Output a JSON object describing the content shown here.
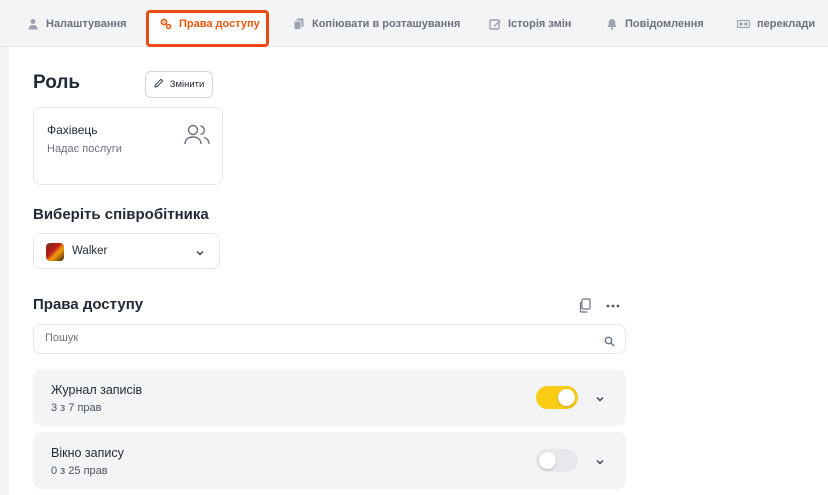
{
  "tabs": [
    {
      "label": "Налаштування",
      "icon": "user-icon",
      "active": false
    },
    {
      "label": "Права доступу",
      "icon": "gears-icon",
      "active": true
    },
    {
      "label": "Копіювати в розташування",
      "icon": "copy-icon",
      "active": false
    },
    {
      "label": "Історія змін",
      "icon": "edit-icon",
      "active": false
    },
    {
      "label": "Повідомлення",
      "icon": "bell-icon",
      "active": false
    },
    {
      "label": "переклади",
      "icon": "translate-icon",
      "active": false
    }
  ],
  "role": {
    "heading": "Роль",
    "edit_label": "Змінити",
    "card": {
      "name": "Фахівець",
      "description": "Надає послуги",
      "icon": "users-icon"
    }
  },
  "employee": {
    "heading": "Виберіть співробітника",
    "selected": "Walker"
  },
  "access": {
    "heading": "Права доступу",
    "search_placeholder": "Пошук",
    "items": [
      {
        "title": "Журнал записів",
        "count": "3 з 7 прав",
        "enabled": true
      },
      {
        "title": "Вікно запису",
        "count": "0 з 25 прав",
        "enabled": false
      }
    ]
  },
  "colors": {
    "accent": "#ea580c",
    "highlight": "#ea4a14",
    "toggle_on": "#facc15",
    "toggle_off": "#e5e7eb"
  }
}
